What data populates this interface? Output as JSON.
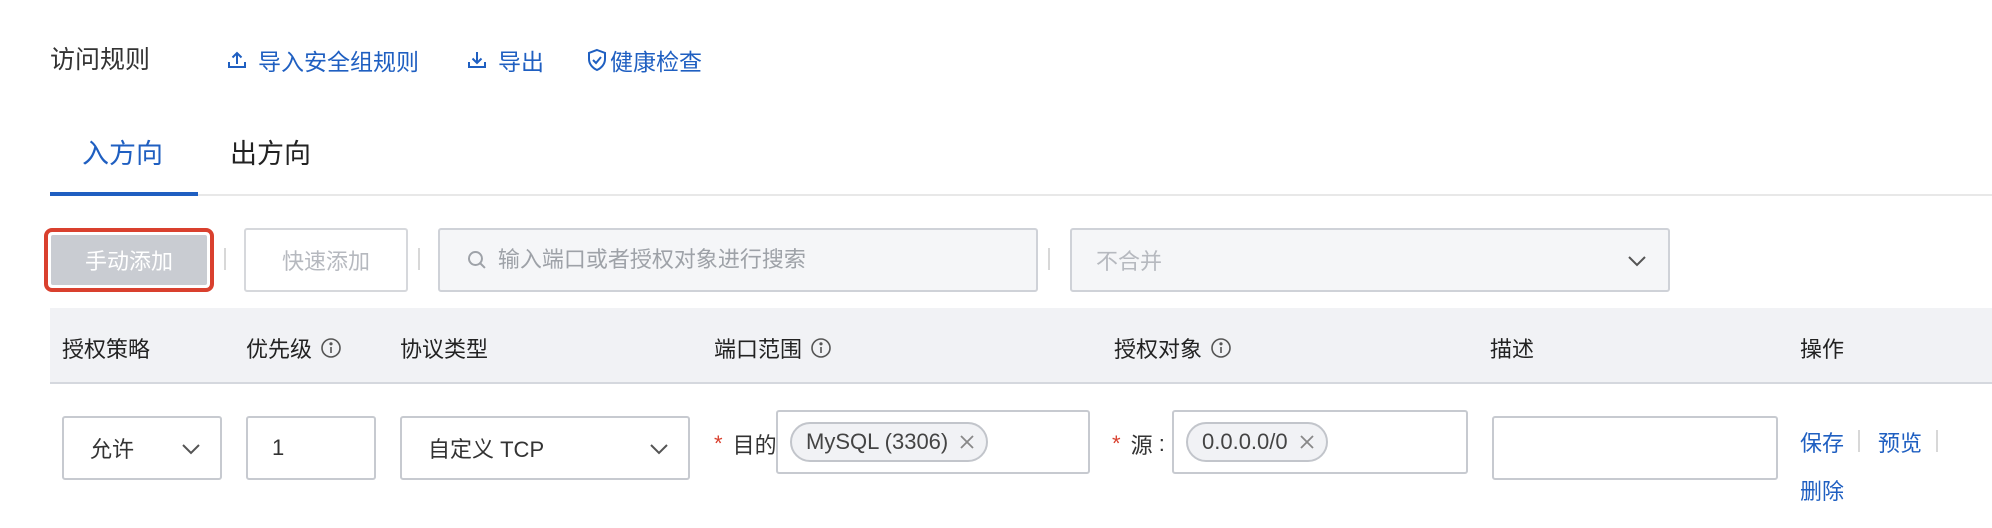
{
  "header": {
    "title": "访问规则",
    "import_label": "导入安全组规则",
    "export_label": "导出",
    "health_label": "健康检查"
  },
  "tabs": [
    {
      "label": "入方向",
      "active": true
    },
    {
      "label": "出方向",
      "active": false
    }
  ],
  "toolbar": {
    "manual_add": "手动添加",
    "quick_add": "快速添加",
    "search_placeholder": "输入端口或者授权对象进行搜索",
    "merge_select": "不合并"
  },
  "table": {
    "columns": [
      "授权策略",
      "优先级",
      "协议类型",
      "端口范围",
      "授权对象",
      "描述",
      "操作"
    ],
    "row": {
      "policy": "允许",
      "priority": "1",
      "protocol": "自定义 TCP",
      "dest_label": "目的",
      "dest_tag": "MySQL (3306)",
      "source_label": "源",
      "source_tag": "0.0.0.0/0",
      "description": "",
      "actions": {
        "save": "保存",
        "preview": "预览",
        "delete": "删除"
      }
    }
  },
  "colors": {
    "accent": "#1f5fc1",
    "highlight_border": "#d9402e",
    "required": "#d9402e"
  },
  "icons": [
    "upload-icon",
    "download-icon",
    "shield-check-icon",
    "search-icon",
    "chevron-down-icon",
    "info-icon",
    "close-icon"
  ]
}
